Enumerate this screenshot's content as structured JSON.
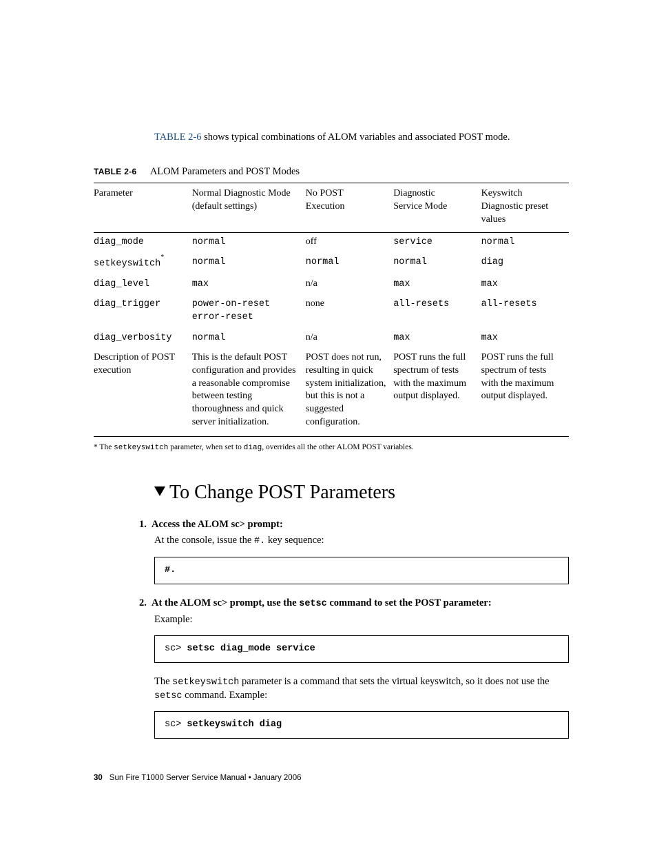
{
  "intro": {
    "link": "TABLE 2-6",
    "rest": " shows typical combinations of ALOM variables and associated POST mode."
  },
  "table": {
    "caption_label": "TABLE 2-6",
    "caption_title": "ALOM Parameters and POST Modes",
    "headers": {
      "c1": "Parameter",
      "c2a": "Normal Diagnostic Mode",
      "c2b": "(default settings)",
      "c3a": "No POST",
      "c3b": "Execution",
      "c4a": "Diagnostic",
      "c4b": "Service Mode",
      "c5a": "Keyswitch Diagnostic preset values"
    },
    "rows": [
      {
        "p": "diag_mode",
        "v": [
          "normal",
          "off",
          "service",
          "normal"
        ],
        "mono_p": true,
        "mono_v": [
          true,
          false,
          true,
          true
        ]
      },
      {
        "p": "setkeyswitch",
        "star": true,
        "v": [
          "normal",
          "normal",
          "normal",
          "diag"
        ],
        "mono_p": true,
        "mono_v": [
          true,
          true,
          true,
          true
        ]
      },
      {
        "p": "diag_level",
        "v": [
          "max",
          "n/a",
          "max",
          "max"
        ],
        "mono_p": true,
        "mono_v": [
          true,
          false,
          true,
          true
        ]
      },
      {
        "p": "diag_trigger",
        "v": [
          "power-on-reset error-reset",
          "none",
          "all-resets",
          "all-resets"
        ],
        "mono_p": true,
        "mono_v": [
          true,
          false,
          true,
          true
        ]
      },
      {
        "p": "diag_verbosity",
        "v": [
          "normal",
          "n/a",
          "max",
          "max"
        ],
        "mono_p": true,
        "mono_v": [
          true,
          false,
          true,
          true
        ]
      },
      {
        "p": "Description of POST execution",
        "v": [
          "This is the default POST configuration and provides a reasonable compromise between testing thoroughness and quick server initialization.",
          "POST does not run, resulting in quick system initialization, but this is not a suggested configuration.",
          "POST runs the full spectrum of tests with the maximum output displayed.",
          "POST runs the full spectrum of tests with the maximum output displayed."
        ],
        "mono_p": false,
        "mono_v": [
          false,
          false,
          false,
          false
        ],
        "last": true
      }
    ]
  },
  "footnote": {
    "pre": "*  The ",
    "m1": "setkeyswitch",
    "mid": " parameter, when set to ",
    "m2": "diag",
    "post": ", overrides all the other ALOM POST variables."
  },
  "section_title": "To Change POST Parameters",
  "steps": [
    {
      "num": "1.",
      "head": "Access the ALOM sc> prompt:",
      "body_pre": "At the console, issue the ",
      "body_mono": "#.",
      "body_post": " key sequence:",
      "code_plain": "",
      "code_bold": "#."
    },
    {
      "num": "2.",
      "head_pre": "At the ALOM sc> prompt, use the ",
      "head_mono": "setsc",
      "head_post": " command to set the POST parameter:",
      "body": "Example:",
      "code_plain": "sc> ",
      "code_bold": "setsc diag_mode service"
    }
  ],
  "para2": {
    "pre": "The ",
    "m1": "setkeyswitch",
    "mid": " parameter is a command that sets the virtual keyswitch, so it does not use the ",
    "m2": "setsc",
    "post": " command. Example:"
  },
  "code3": {
    "plain": "sc> ",
    "bold": "setkeyswitch diag"
  },
  "footer": {
    "page": "30",
    "text": "Sun Fire T1000 Server Service Manual • January 2006"
  }
}
